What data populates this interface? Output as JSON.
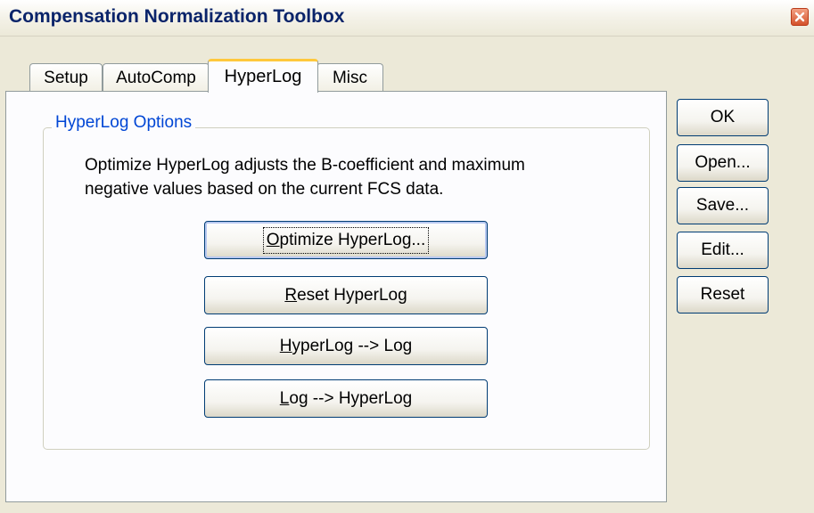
{
  "window": {
    "title": "Compensation Normalization Toolbox",
    "close_icon": "close-icon"
  },
  "tabs": [
    {
      "label": "Setup"
    },
    {
      "label": "AutoComp"
    },
    {
      "label": "HyperLog",
      "active": true
    },
    {
      "label": "Misc"
    }
  ],
  "group": {
    "title": "HyperLog Options",
    "description_line1": "Optimize HyperLog adjusts the B-coefficient and maximum",
    "description_line2": "negative values based on the current FCS data."
  },
  "hyperlog_buttons": [
    {
      "mnemonic": "O",
      "rest": "ptimize HyperLog..."
    },
    {
      "mnemonic": "R",
      "rest": "eset HyperLog"
    },
    {
      "mnemonic": "H",
      "rest": "yperLog --> Log"
    },
    {
      "mnemonic": "L",
      "rest": "og --> HyperLog"
    }
  ],
  "side_buttons": {
    "ok": "OK",
    "open": "Open...",
    "save": "Save...",
    "edit": "Edit...",
    "reset": "Reset"
  },
  "colors": {
    "title_text": "#0a246a",
    "group_title": "#0046d5",
    "active_tab_accent": "#ffc83c",
    "button_border": "#003c74"
  }
}
